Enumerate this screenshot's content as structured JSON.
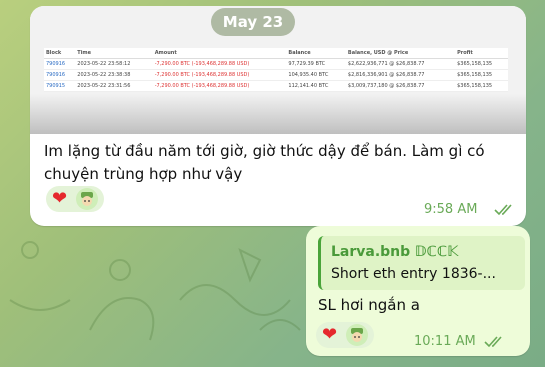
{
  "date_chip": "May 23",
  "incoming": {
    "screenshot_table": {
      "headers": [
        "Block",
        "Time",
        "Amount",
        "Balance",
        "Balance, USD @ Price",
        "Profit"
      ],
      "rows": [
        [
          "790916",
          "2023-05-22 23:58:12",
          "-7,290.00 BTC (-193,468,289.88 USD)",
          "97,729.39 BTC",
          "$2,622,936,771 @ $26,838.77",
          "$365,158,135"
        ],
        [
          "790916",
          "2023-05-22 23:38:38",
          "-7,290.00 BTC (-193,468,289.88 USD)",
          "104,935.40 BTC",
          "$2,816,336,901 @ $26,838.77",
          "$365,158,135"
        ],
        [
          "790915",
          "2023-05-22 23:31:56",
          "-7,290.00 BTC (-193,468,289.88 USD)",
          "112,141.40 BTC",
          "$3,009,737,180 @ $26,838.77",
          "$365,158,135"
        ]
      ]
    },
    "caption": "Im lặng từ đầu năm tới giờ, giờ thức dậy để bán. Làm gì có chuyện trùng hợp như vậy",
    "reaction": "heart",
    "time": "9:58 AM"
  },
  "outgoing": {
    "reply_name": "Larva.bnb 𝔻ℂℂ𝕂",
    "reply_text": "Short eth entry 1836-...",
    "text": "SL hơi ngắn a",
    "reaction": "heart",
    "time": "10:11 AM"
  },
  "colors": {
    "accent": "#4aa43a",
    "time": "#6aaa58",
    "heart": "#e5282d"
  }
}
